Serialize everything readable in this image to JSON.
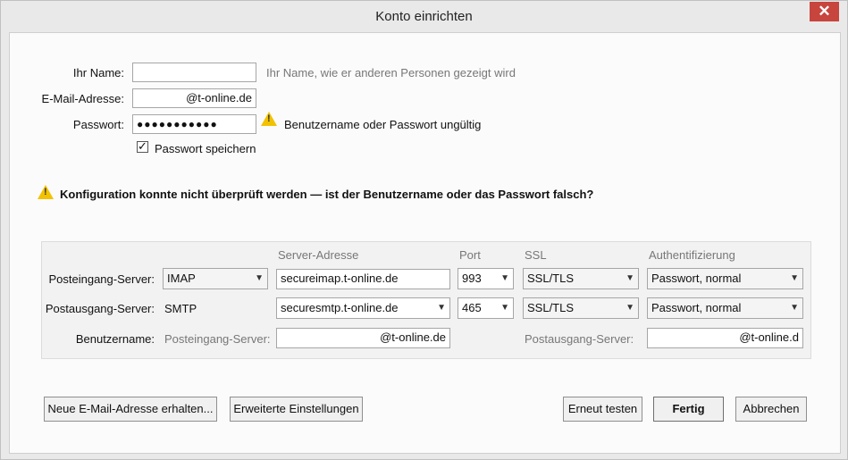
{
  "window": {
    "title": "Konto einrichten",
    "close_glyph": "✕"
  },
  "form": {
    "name": {
      "label": "Ihr Name:",
      "value": "",
      "hint": "Ihr Name, wie er anderen Personen gezeigt wird"
    },
    "email": {
      "label": "E-Mail-Adresse:",
      "value": "@t-online.de"
    },
    "password": {
      "label": "Passwort:",
      "value": "●●●●●●●●●●●",
      "error": "Benutzername oder Passwort ungültig"
    },
    "remember": {
      "label": "Passwort speichern",
      "checked": true
    }
  },
  "warning": {
    "text": "Konfiguration konnte nicht überprüft werden — ist der Benutzername oder das Passwort falsch?"
  },
  "server_table": {
    "headers": {
      "address": "Server-Adresse",
      "port": "Port",
      "ssl": "SSL",
      "auth": "Authentifizierung"
    },
    "incoming": {
      "label": "Posteingang-Server:",
      "type": "IMAP",
      "address": "secureimap.t-online.de",
      "port": "993",
      "ssl": "SSL/TLS",
      "auth": "Passwort, normal"
    },
    "outgoing": {
      "label": "Postausgang-Server:",
      "type": "SMTP",
      "address": "securesmtp.t-online.de",
      "port": "465",
      "ssl": "SSL/TLS",
      "auth": "Passwort, normal"
    },
    "username": {
      "label": "Benutzername:",
      "incoming_label": "Posteingang-Server:",
      "incoming_value": "@t-online.de",
      "outgoing_label": "Postausgang-Server:",
      "outgoing_value": "@t-online.d"
    }
  },
  "buttons": {
    "new_email": "Neue E-Mail-Adresse erhalten...",
    "advanced": "Erweiterte Einstellungen",
    "retest": "Erneut testen",
    "done": "Fertig",
    "cancel": "Abbrechen"
  },
  "icons": {
    "warning": "warning-triangle-icon",
    "dropdown": "chevron-down-icon",
    "check": "checkmark-icon"
  },
  "colors": {
    "close_button": "#c7453d",
    "warning_icon": "#f2c200"
  }
}
